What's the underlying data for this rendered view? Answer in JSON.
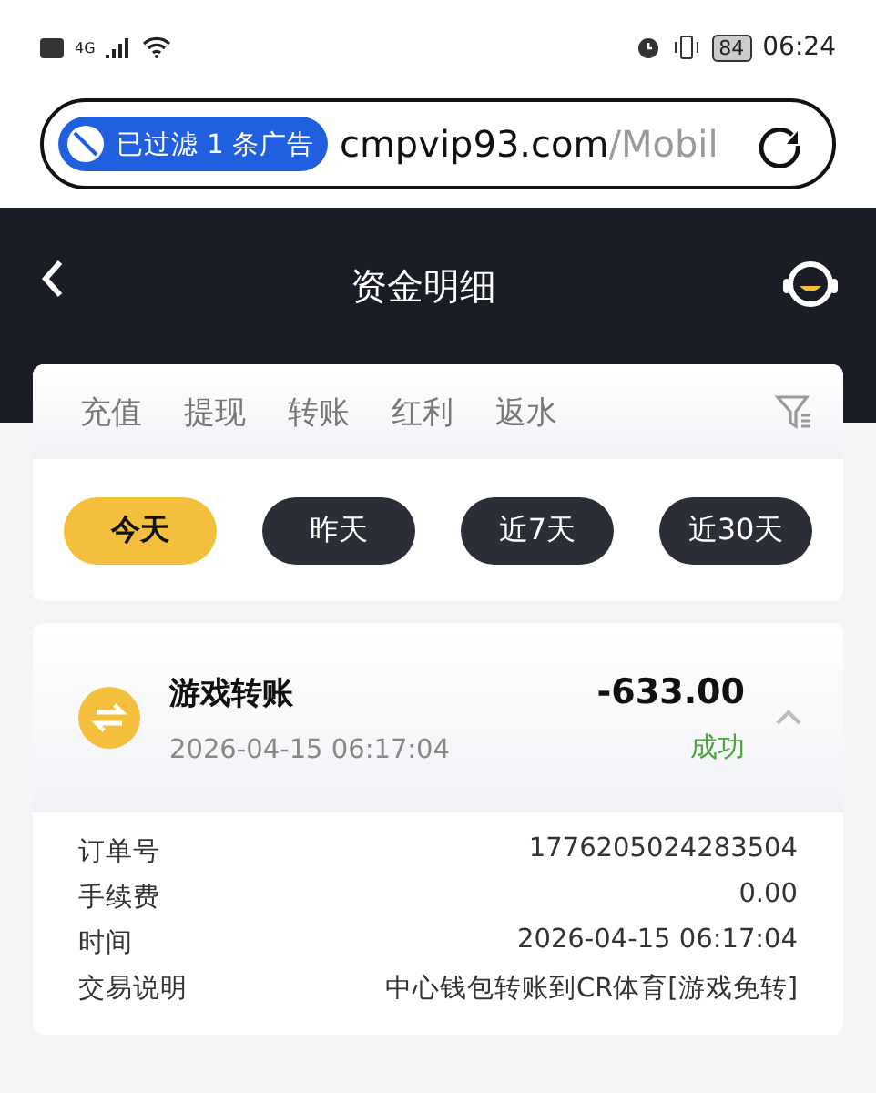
{
  "status_bar": {
    "network": "4G",
    "battery": "84",
    "time": "06:24"
  },
  "browser": {
    "ad_badge": "已过滤 1 条广告",
    "url_host": "cmpvip93.com",
    "url_path": "/Mobil"
  },
  "header": {
    "title": "资金明细"
  },
  "tabs": [
    {
      "label": "充值",
      "selected": false
    },
    {
      "label": "提现",
      "selected": false
    },
    {
      "label": "转账",
      "selected": false
    },
    {
      "label": "红利",
      "selected": false
    },
    {
      "label": "返水",
      "selected": false
    }
  ],
  "periods": [
    {
      "label": "今天",
      "selected": true
    },
    {
      "label": "昨天",
      "selected": false
    },
    {
      "label": "近7天",
      "selected": false
    },
    {
      "label": "近30天",
      "selected": false
    }
  ],
  "transaction": {
    "title": "游戏转账",
    "time": "2026-04-15 06:17:04",
    "amount": "-633.00",
    "status": "成功",
    "expanded": true,
    "details": [
      {
        "label": "订单号",
        "value": "1776205024283504"
      },
      {
        "label": "手续费",
        "value": "0.00"
      },
      {
        "label": "时间",
        "value": "2026-04-15 06:17:04"
      },
      {
        "label": "交易说明",
        "value": "中心钱包转账到CR体育[游戏免转]"
      }
    ]
  }
}
